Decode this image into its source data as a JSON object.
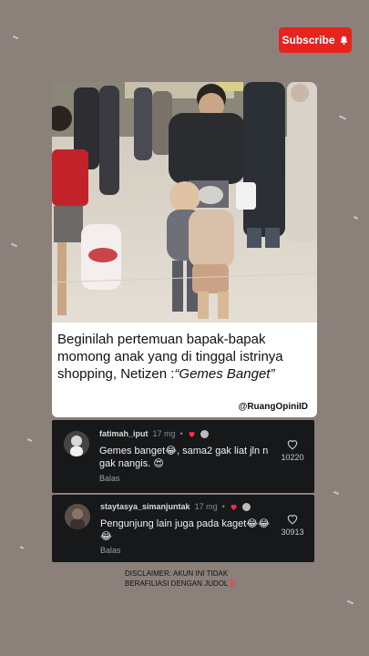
{
  "subscribe": {
    "label": "Subscribe",
    "color": "#e5231f"
  },
  "post": {
    "caption_main": "Beginilah pertemuan bapak-bapak momong anak yang di tinggal istrinya shopping, Netizen :",
    "caption_quote": "“Gemes Banget”",
    "handle": "@RuangOpiniID"
  },
  "comments": [
    {
      "username": "fatimah_iput",
      "time": "17 mg",
      "text": "Gemes banget😂, sama2 gak liat jln n gak nangis. 😍",
      "reply": "Balas",
      "likes": "10220"
    },
    {
      "username": "staytasya_simanjuntak",
      "time": "17 mg",
      "text": "Pengunjung lain juga pada kaget😂😂😂",
      "reply": "Balas",
      "likes": "30913"
    }
  ],
  "disclaimer": {
    "text": "DISCLAIMER: AKUN INI TIDAK BERAFILIASI DENGAN JUDOL",
    "mark": "‼️"
  },
  "icons": {
    "bell": "bell-icon",
    "heart": "heart-outline-icon",
    "heart_small": "heart-filled-icon"
  }
}
